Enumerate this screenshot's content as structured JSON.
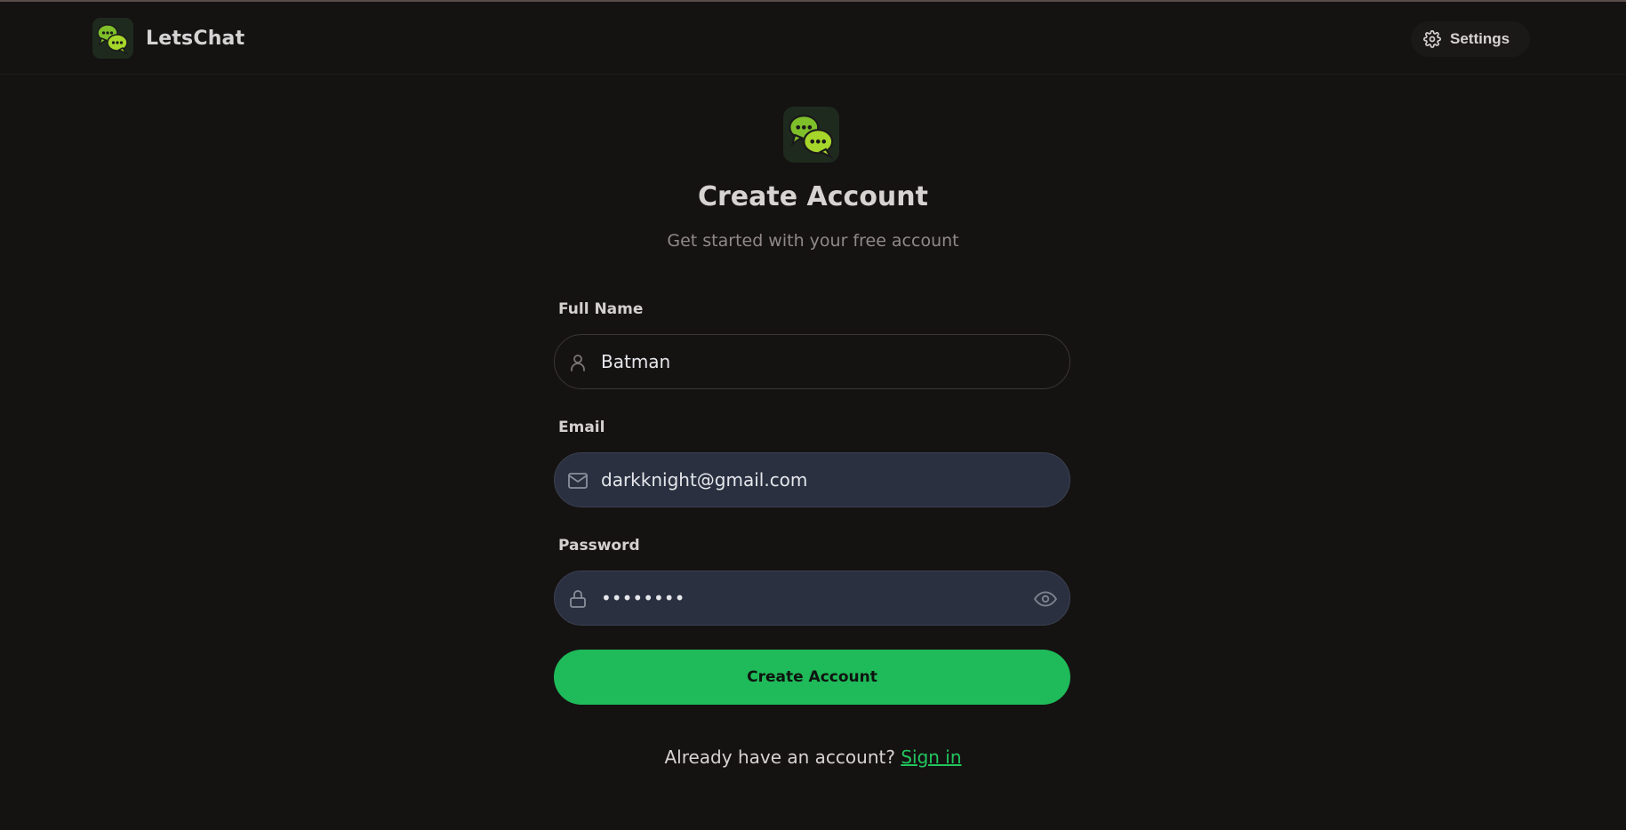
{
  "header": {
    "app_name": "LetsChat",
    "settings_label": "Settings"
  },
  "hero": {
    "title": "Create Account",
    "subtitle": "Get started with your free account"
  },
  "form": {
    "full_name": {
      "label": "Full Name",
      "value": "Batman",
      "icon": "user-icon"
    },
    "email": {
      "label": "Email",
      "value": "darkknight@gmail.com",
      "icon": "mail-icon"
    },
    "password": {
      "label": "Password",
      "value": "••••••••",
      "icon": "lock-icon"
    },
    "submit_label": "Create Account"
  },
  "footer": {
    "prompt": "Already have an account?",
    "signin_label": "Sign in"
  },
  "colors": {
    "background": "#151212",
    "accent": "#1fba59",
    "filled_input": "#2a3040",
    "logo_green": "#8cc63f"
  }
}
